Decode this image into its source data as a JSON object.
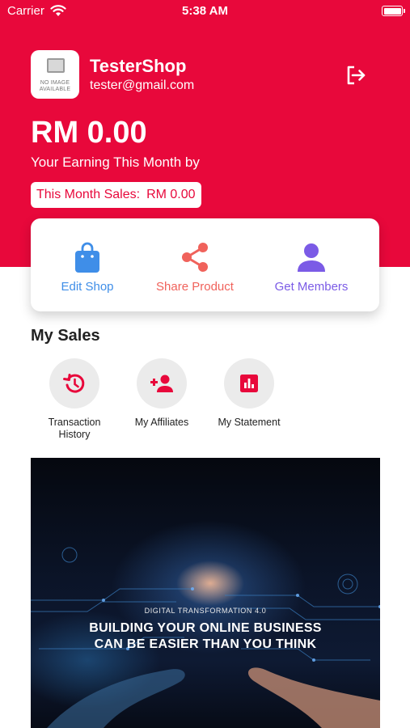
{
  "status_bar": {
    "carrier": "Carrier",
    "time": "5:38 AM"
  },
  "profile": {
    "logo_placeholder": "NO IMAGE AVAILABLE",
    "shop_name": "TesterShop",
    "email": "tester@gmail.com"
  },
  "earnings": {
    "amount": "RM 0.00",
    "label": "Your Earning This Month by",
    "sales_label": "This Month Sales:",
    "sales_amount": "RM 0.00"
  },
  "actions": [
    {
      "label": "Edit Shop",
      "icon": "shopping-bag-icon",
      "color": "#3f8ee8"
    },
    {
      "label": "Share Product",
      "icon": "share-icon",
      "color": "#f0625b"
    },
    {
      "label": "Get Members",
      "icon": "person-icon",
      "color": "#7b5be6"
    }
  ],
  "my_sales": {
    "title": "My Sales",
    "items": [
      {
        "label": "Transaction History",
        "icon": "history-icon"
      },
      {
        "label": "My Affiliates",
        "icon": "add-person-icon"
      },
      {
        "label": "My Statement",
        "icon": "bar-chart-icon"
      }
    ]
  },
  "banner": {
    "kicker": "DIGITAL TRANSFORMATION 4.0",
    "line1": "BUILDING YOUR ONLINE BUSINESS",
    "line2": "CAN BE EASIER THAN YOU THINK"
  },
  "colors": {
    "brand": "#e8083b",
    "accent_red": "#e8083b",
    "icon_circle": "#ebebeb"
  }
}
